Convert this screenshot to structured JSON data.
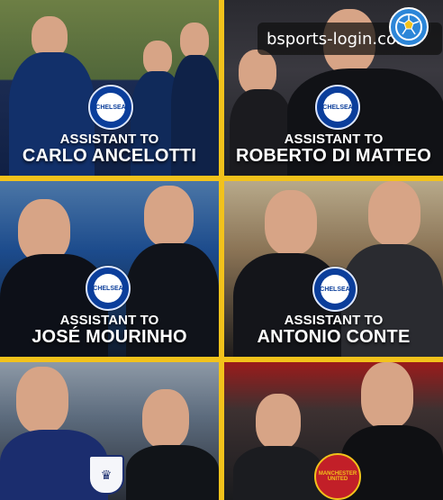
{
  "watermark": {
    "text": "bsports-login.com",
    "icon": "soccer-ball-icon"
  },
  "tiles": [
    {
      "caption_small": "ASSISTANT TO",
      "caption_big": "CARLO ANCELOTTI",
      "badge": "chelsea-crest"
    },
    {
      "caption_small": "ASSISTANT TO",
      "caption_big": "ROBERTO DI MATTEO",
      "badge": "chelsea-crest"
    },
    {
      "caption_small": "ASSISTANT TO",
      "caption_big": "JOSÉ MOURINHO",
      "badge": "chelsea-crest"
    },
    {
      "caption_small": "ASSISTANT TO",
      "caption_big": "ANTONIO CONTE",
      "badge": "chelsea-crest"
    },
    {
      "caption_small": "",
      "caption_big": "",
      "badge": "england-crest"
    },
    {
      "caption_small": "",
      "caption_big": "",
      "badge": "manchester-united-crest"
    }
  ],
  "crests": {
    "chelsea": "CHELSEA",
    "manchester_united": "MANCHESTER UNITED"
  },
  "colors": {
    "frame": "#f2c21b",
    "chelsea_blue": "#0b3e9b",
    "manchester_red": "#c21f28"
  }
}
